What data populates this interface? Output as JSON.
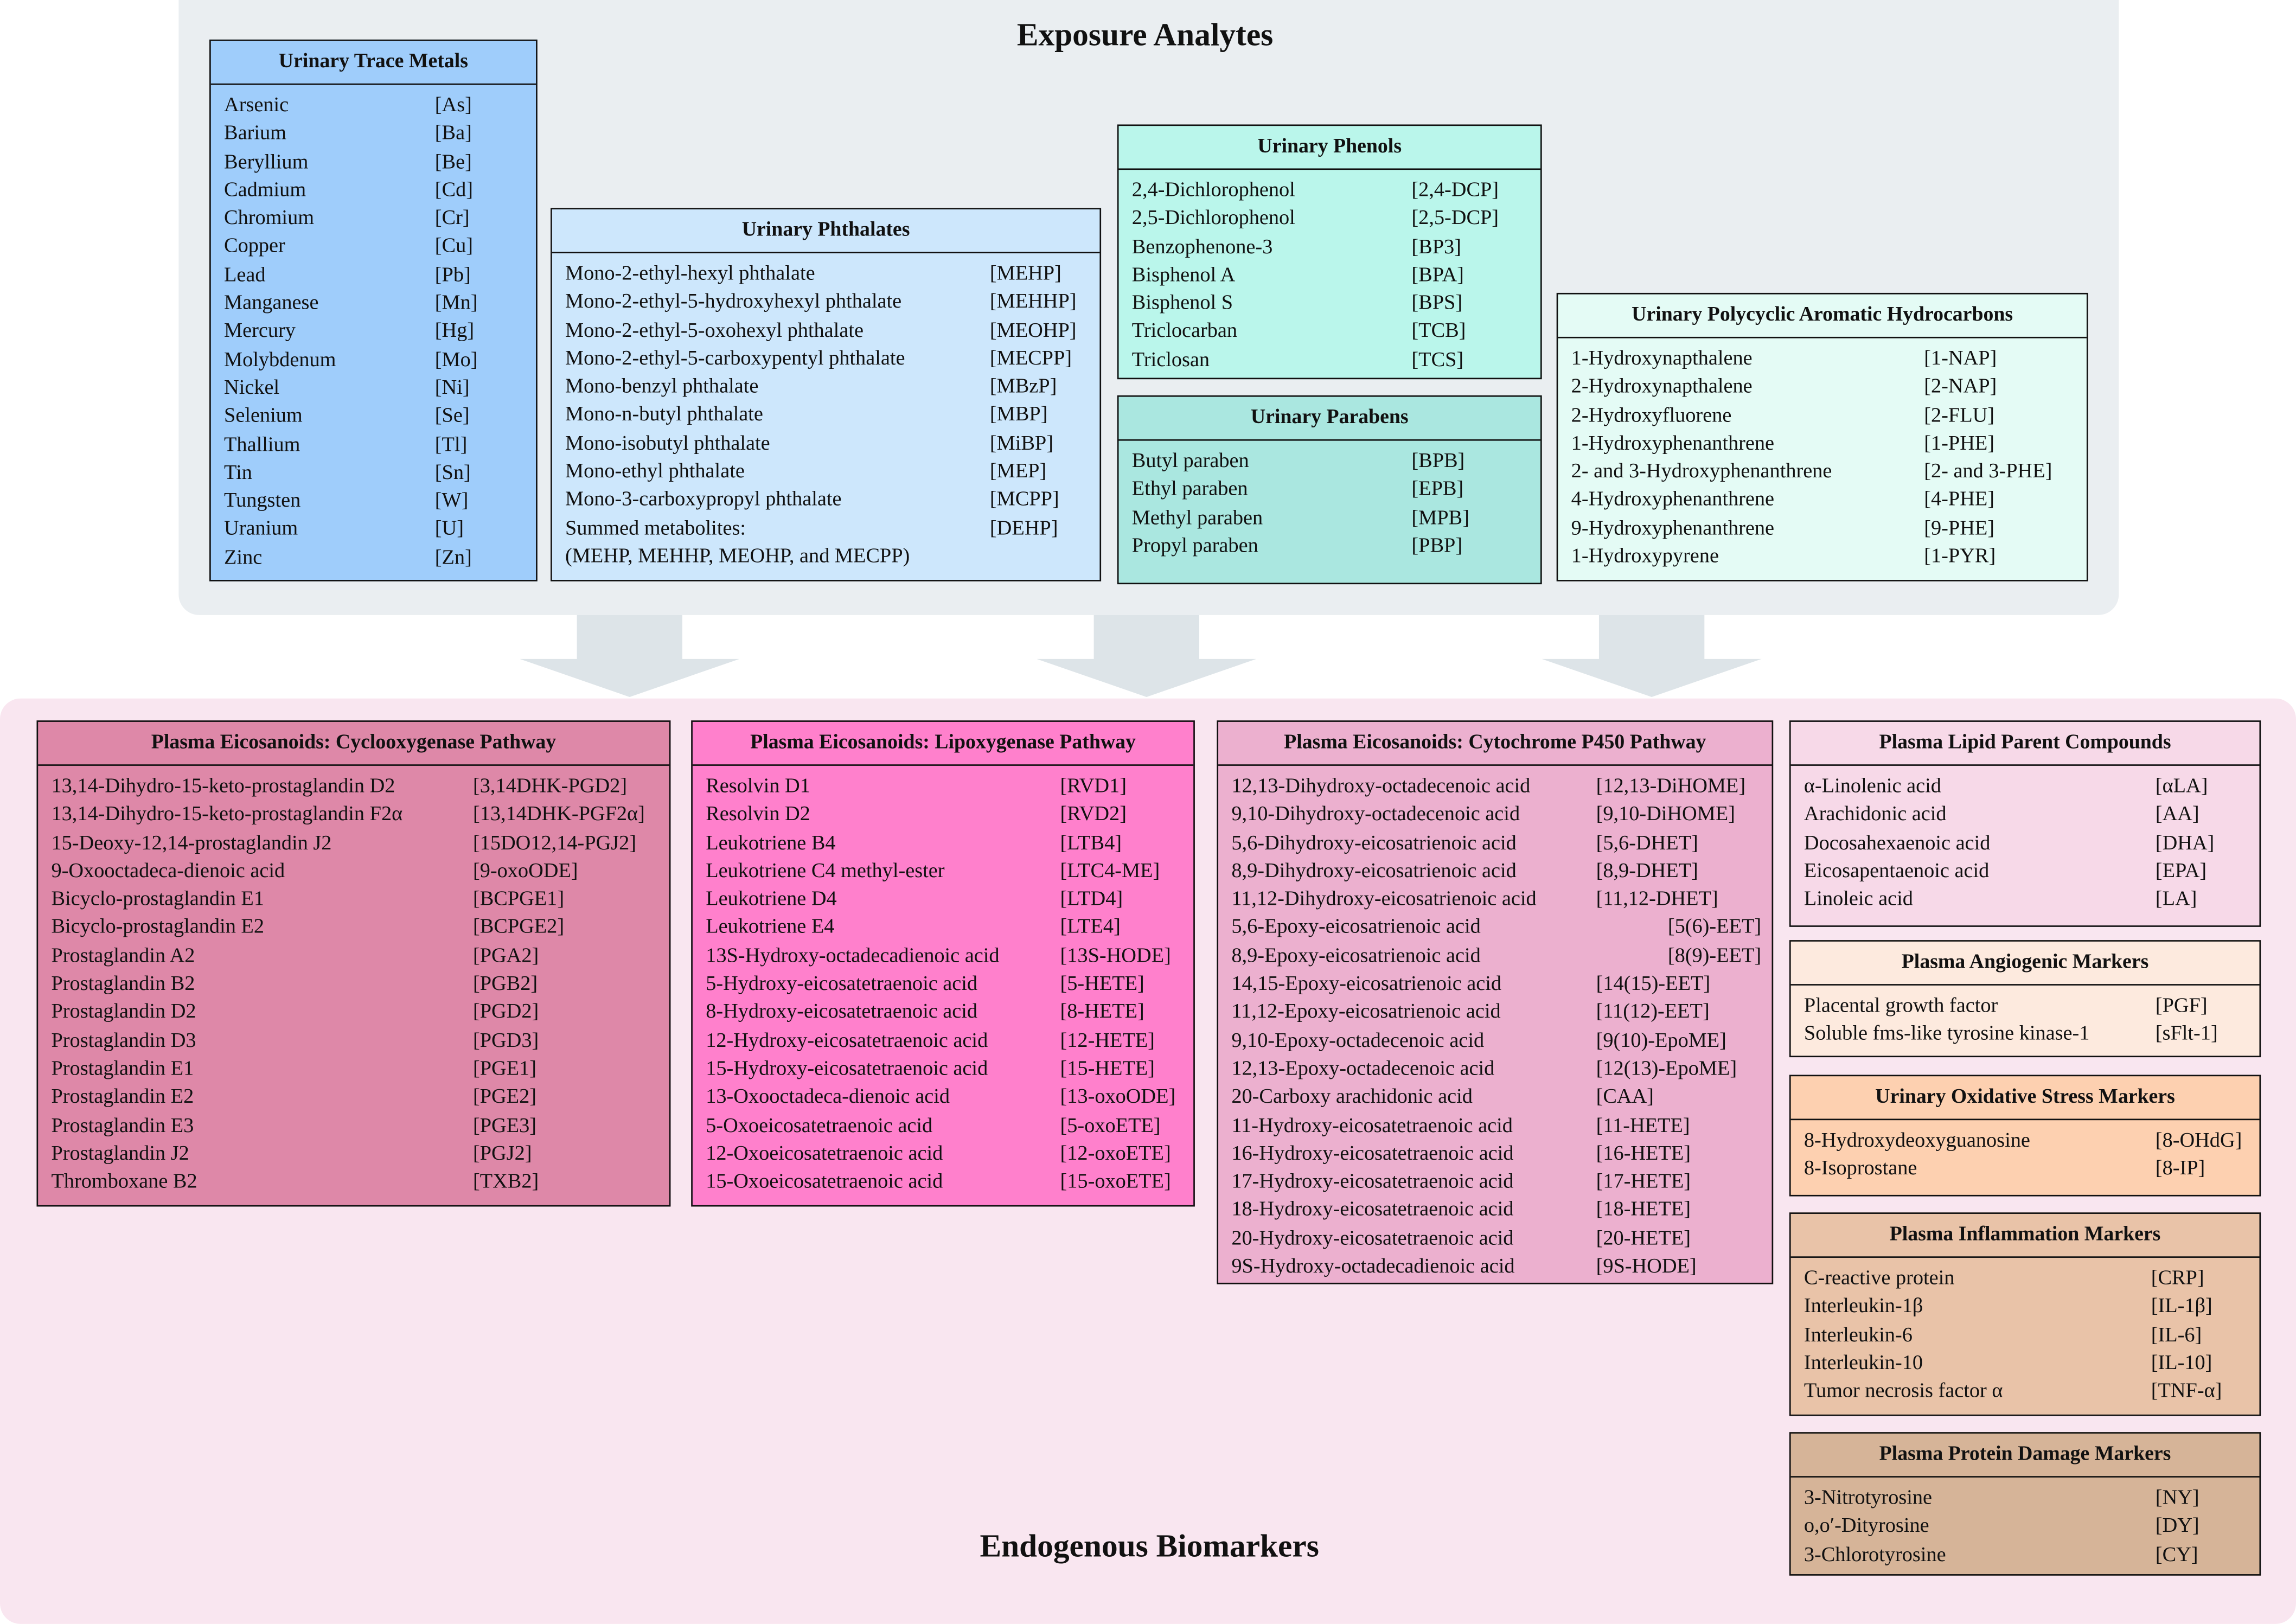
{
  "exposure_title": "Exposure Analytes",
  "endogenous_title": "Endogenous Biomarkers",
  "boxes": [
    {
      "id": "urinary-trace-metals",
      "title": "Urinary Trace Metals",
      "color": "#9fcdfb",
      "items": [
        [
          "Arsenic",
          "[As]"
        ],
        [
          "Barium",
          "[Ba]"
        ],
        [
          "Beryllium",
          "[Be]"
        ],
        [
          "Cadmium",
          "[Cd]"
        ],
        [
          "Chromium",
          "[Cr]"
        ],
        [
          "Copper",
          "[Cu]"
        ],
        [
          "Lead",
          "[Pb]"
        ],
        [
          "Manganese",
          "[Mn]"
        ],
        [
          "Mercury",
          "[Hg]"
        ],
        [
          "Molybdenum",
          "[Mo]"
        ],
        [
          "Nickel",
          "[Ni]"
        ],
        [
          "Selenium",
          "[Se]"
        ],
        [
          "Thallium",
          "[Tl]"
        ],
        [
          "Tin",
          "[Sn]"
        ],
        [
          "Tungsten",
          "[W]"
        ],
        [
          "Uranium",
          "[U]"
        ],
        [
          "Zinc",
          "[Zn]"
        ]
      ]
    },
    {
      "id": "urinary-phthalates",
      "title": "Urinary Phthalates",
      "color": "#cde7fc",
      "items": [
        [
          "Mono-2-ethyl-hexyl phthalate",
          "[MEHP]"
        ],
        [
          "Mono-2-ethyl-5-hydroxyhexyl phthalate",
          "[MEHHP]"
        ],
        [
          "Mono-2-ethyl-5-oxohexyl phthalate",
          "[MEOHP]"
        ],
        [
          "Mono-2-ethyl-5-carboxypentyl phthalate",
          "[MECPP]"
        ],
        [
          "Mono-benzyl phthalate",
          "[MBzP]"
        ],
        [
          "Mono-n-butyl phthalate",
          "[MBP]"
        ],
        [
          "Mono-isobutyl phthalate",
          "[MiBP]"
        ],
        [
          "Mono-ethyl phthalate",
          "[MEP]"
        ],
        [
          "Mono-3-carboxypropyl phthalate",
          "[MCPP]"
        ],
        [
          "Summed metabolites:",
          "[DEHP]"
        ],
        [
          "(MEHP, MEHHP, MEOHP, and MECPP)",
          ""
        ]
      ]
    },
    {
      "id": "urinary-phenols",
      "title": "Urinary Phenols",
      "color": "#baf6eb",
      "items": [
        [
          "2,4-Dichlorophenol",
          "[2,4-DCP]"
        ],
        [
          "2,5-Dichlorophenol",
          "[2,5-DCP]"
        ],
        [
          "Benzophenone-3",
          "[BP3]"
        ],
        [
          "Bisphenol A",
          "[BPA]"
        ],
        [
          "Bisphenol S",
          "[BPS]"
        ],
        [
          "Triclocarban",
          "[TCB]"
        ],
        [
          "Triclosan",
          "[TCS]"
        ]
      ]
    },
    {
      "id": "urinary-parabens",
      "title": "Urinary Parabens",
      "color": "#aae7e0",
      "items": [
        [
          "Butyl paraben",
          "[BPB]"
        ],
        [
          "Ethyl paraben",
          "[EPB]"
        ],
        [
          "Methyl paraben",
          "[MPB]"
        ],
        [
          "Propyl paraben",
          "[PBP]"
        ]
      ]
    },
    {
      "id": "urinary-pah",
      "title": "Urinary Polycyclic Aromatic Hydrocarbons",
      "color": "#e4fbf5",
      "items": [
        [
          "1-Hydroxynapthalene",
          "[1-NAP]"
        ],
        [
          "2-Hydroxynapthalene",
          "[2-NAP]"
        ],
        [
          "2-Hydroxyfluorene",
          "[2-FLU]"
        ],
        [
          "1-Hydroxyphenanthrene",
          "[1-PHE]"
        ],
        [
          "2- and 3-Hydroxyphenanthrene",
          "[2- and 3-PHE]"
        ],
        [
          "4-Hydroxyphenanthrene",
          "[4-PHE]"
        ],
        [
          "9-Hydroxyphenanthrene",
          "[9-PHE]"
        ],
        [
          "1-Hydroxypyrene",
          "[1-PYR]"
        ]
      ]
    },
    {
      "id": "plasma-eicosanoids-cox",
      "title": "Plasma Eicosanoids: Cyclooxygenase Pathway",
      "color": "#de88a8",
      "items": [
        [
          "13,14-Dihydro-15-keto-prostaglandin D2",
          "[3,14DHK-PGD2]"
        ],
        [
          "13,14-Dihydro-15-keto-prostaglandin F2α",
          "[13,14DHK-PGF2α]"
        ],
        [
          "15-Deoxy-12,14-prostaglandin J2",
          "[15DO12,14-PGJ2]"
        ],
        [
          "9-Oxooctadeca-dienoic acid",
          "[9-oxoODE]"
        ],
        [
          "Bicyclo-prostaglandin E1",
          "[BCPGE1]"
        ],
        [
          "Bicyclo-prostaglandin E2",
          "[BCPGE2]"
        ],
        [
          "Prostaglandin A2",
          "[PGA2]"
        ],
        [
          "Prostaglandin B2",
          "[PGB2]"
        ],
        [
          "Prostaglandin D2",
          "[PGD2]"
        ],
        [
          "Prostaglandin D3",
          "[PGD3]"
        ],
        [
          "Prostaglandin E1",
          "[PGE1]"
        ],
        [
          "Prostaglandin E2",
          "[PGE2]"
        ],
        [
          "Prostaglandin E3",
          "[PGE3]"
        ],
        [
          "Prostaglandin J2",
          "[PGJ2]"
        ],
        [
          "Thromboxane B2",
          "[TXB2]"
        ]
      ]
    },
    {
      "id": "plasma-eicosanoids-lox",
      "title": "Plasma Eicosanoids: Lipoxygenase Pathway",
      "color": "#ff80cc",
      "items": [
        [
          "Resolvin D1",
          "[RVD1]"
        ],
        [
          "Resolvin D2",
          "[RVD2]"
        ],
        [
          "Leukotriene B4",
          "[LTB4]"
        ],
        [
          "Leukotriene C4 methyl-ester",
          "[LTC4-ME]"
        ],
        [
          "Leukotriene D4",
          "[LTD4]"
        ],
        [
          "Leukotriene E4",
          "[LTE4]"
        ],
        [
          "13S-Hydroxy-octadecadienoic acid",
          "[13S-HODE]"
        ],
        [
          "5-Hydroxy-eicosatetraenoic acid",
          "[5-HETE]"
        ],
        [
          "8-Hydroxy-eicosatetraenoic acid",
          "[8-HETE]"
        ],
        [
          "12-Hydroxy-eicosatetraenoic acid",
          "[12-HETE]"
        ],
        [
          "15-Hydroxy-eicosatetraenoic acid",
          "[15-HETE]"
        ],
        [
          "13-Oxooctadeca-dienoic acid",
          "[13-oxoODE]"
        ],
        [
          "5-Oxoeicosatetraenoic acid",
          "[5-oxoETE]"
        ],
        [
          "12-Oxoeicosatetraenoic acid",
          "[12-oxoETE]"
        ],
        [
          "15-Oxoeicosatetraenoic acid",
          "[15-oxoETE]"
        ]
      ]
    },
    {
      "id": "plasma-eicosanoids-cyp450",
      "title": "Plasma Eicosanoids: Cytochrome P450 Pathway",
      "color": "#ecb0cf",
      "items": [
        [
          "12,13-Dihydroxy-octadecenoic acid",
          "[12,13-DiHOME]"
        ],
        [
          "9,10-Dihydroxy-octadecenoic acid",
          "[9,10-DiHOME]"
        ],
        [
          "5,6-Dihydroxy-eicosatrienoic acid",
          "[5,6-DHET]"
        ],
        [
          "8,9-Dihydroxy-eicosatrienoic acid",
          "[8,9-DHET]"
        ],
        [
          "11,12-Dihydroxy-eicosatrienoic acid",
          "[11,12-DHET]"
        ],
        [
          "5,6-Epoxy-eicosatrienoic acid",
          "[5(6)-EET]"
        ],
        [
          "8,9-Epoxy-eicosatrienoic acid",
          "[8(9)-EET]"
        ],
        [
          "14,15-Epoxy-eicosatrienoic acid",
          "[14(15)-EET]"
        ],
        [
          "11,12-Epoxy-eicosatrienoic acid",
          "[11(12)-EET]"
        ],
        [
          "9,10-Epoxy-octadecenoic acid",
          "[9(10)-EpoME]"
        ],
        [
          "12,13-Epoxy-octadecenoic acid",
          "[12(13)-EpoME]"
        ],
        [
          "20-Carboxy arachidonic acid",
          "[CAA]"
        ],
        [
          "11-Hydroxy-eicosatetraenoic acid",
          "[11-HETE]"
        ],
        [
          "16-Hydroxy-eicosatetraenoic acid",
          "[16-HETE]"
        ],
        [
          "17-Hydroxy-eicosatetraenoic acid",
          "[17-HETE]"
        ],
        [
          "18-Hydroxy-eicosatetraenoic acid",
          "[18-HETE]"
        ],
        [
          "20-Hydroxy-eicosatetraenoic acid",
          "[20-HETE]"
        ],
        [
          "9S-Hydroxy-octadecadienoic acid",
          "[9S-HODE]"
        ]
      ]
    },
    {
      "id": "plasma-lipid-parent",
      "title": "Plasma Lipid Parent Compounds",
      "color": "#f7d9e8",
      "items": [
        [
          "α-Linolenic acid",
          "[αLA]"
        ],
        [
          "Arachidonic acid",
          "[AA]"
        ],
        [
          "Docosahexaenoic acid",
          "[DHA]"
        ],
        [
          "Eicosapentaenoic acid",
          "[EPA]"
        ],
        [
          "Linoleic acid",
          "[LA]"
        ]
      ]
    },
    {
      "id": "plasma-angiogenic",
      "title": "Plasma Angiogenic Markers",
      "color": "#fdeade",
      "items": [
        [
          "Placental growth factor",
          "[PGF]"
        ],
        [
          "Soluble fms-like tyrosine kinase-1",
          "[sFlt-1]"
        ]
      ]
    },
    {
      "id": "urinary-oxidative-stress",
      "title": "Urinary Oxidative Stress Markers",
      "color": "#fdd0b0",
      "items": [
        [
          "8-Hydroxydeoxyguanosine",
          "[8-OHdG]"
        ],
        [
          "8-Isoprostane",
          "[8-IP]"
        ]
      ]
    },
    {
      "id": "plasma-inflammation",
      "title": "Plasma Inflammation Markers",
      "color": "#e9c3a8",
      "items": [
        [
          "C-reactive protein",
          "[CRP]"
        ],
        [
          "Interleukin-1β",
          "[IL-1β]"
        ],
        [
          "Interleukin-6",
          "[IL-6]"
        ],
        [
          "Interleukin-10",
          "[IL-10]"
        ],
        [
          "Tumor necrosis factor α",
          "[TNF-α]"
        ]
      ]
    },
    {
      "id": "plasma-protein-damage",
      "title": "Plasma Protein Damage Markers",
      "color": "#d6b498",
      "items": [
        [
          "3-Nitrotyrosine",
          "[NY]"
        ],
        [
          "o,o′-Dityrosine",
          "[DY]"
        ],
        [
          "3-Chlorotyrosine",
          "[CY]"
        ]
      ]
    }
  ]
}
